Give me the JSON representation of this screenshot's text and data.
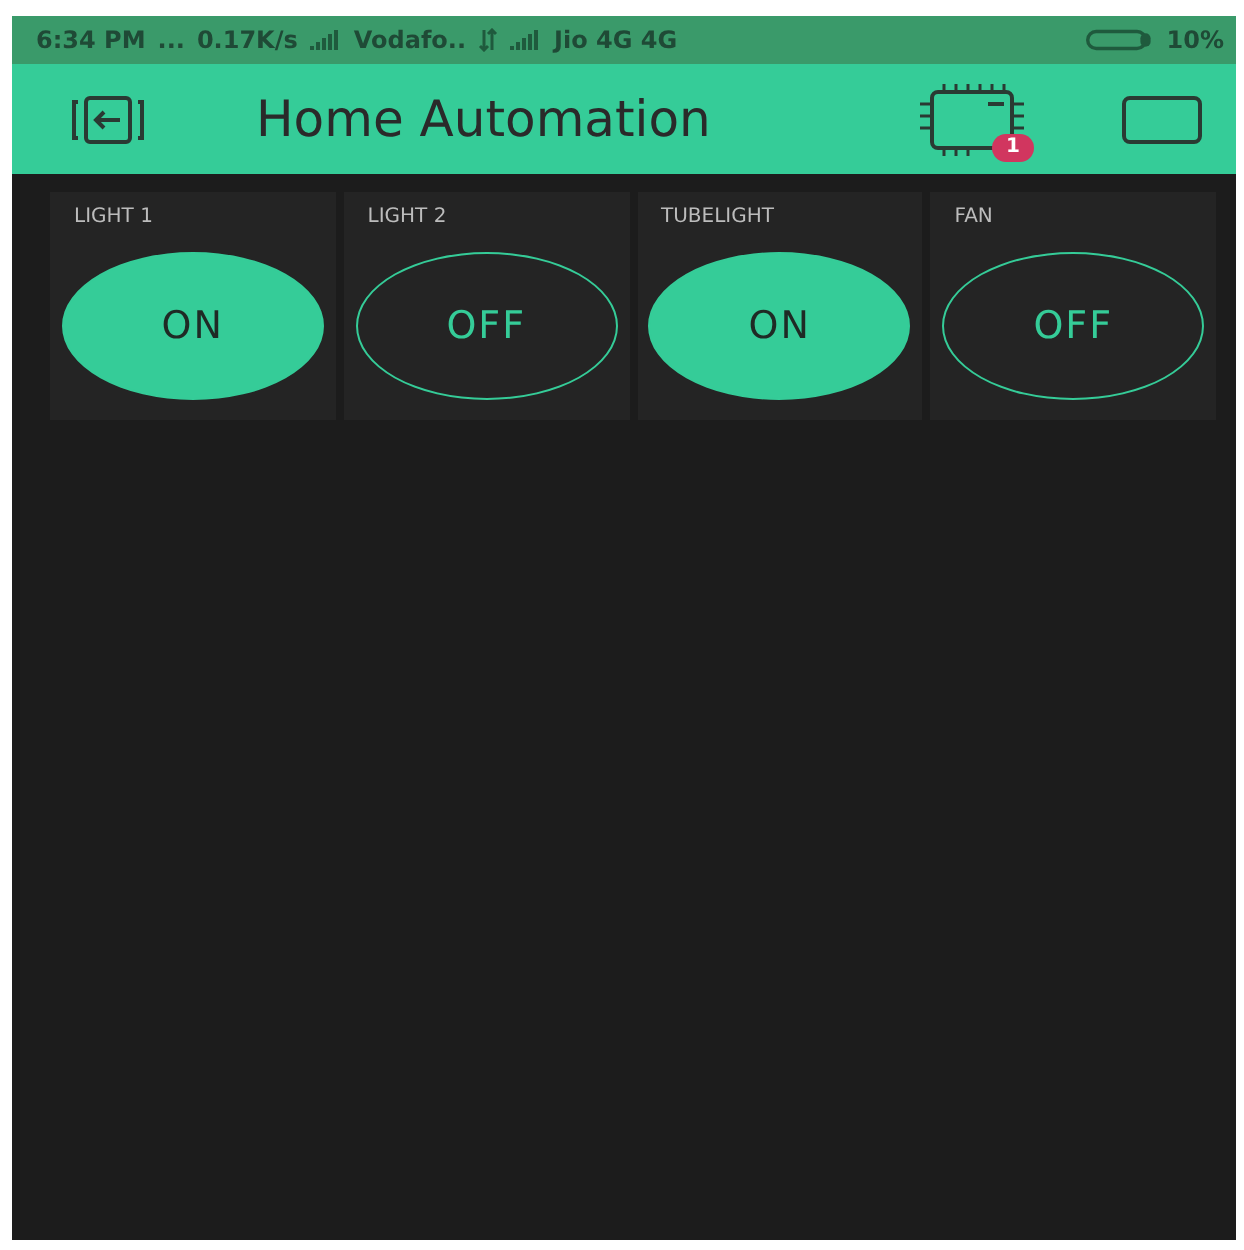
{
  "status_bar": {
    "time": "6:34 PM",
    "dots": "...",
    "speed": "0.17K/s",
    "carrier_1": "Vodafo..",
    "carrier_2": "Jio 4G 4G",
    "battery": "10%"
  },
  "header": {
    "title": "Home Automation",
    "badge": "1"
  },
  "widgets": [
    {
      "label": "LIGHT 1",
      "on": true,
      "text": "ON"
    },
    {
      "label": "LIGHT 2",
      "on": false,
      "text": "OFF"
    },
    {
      "label": "TUBELIGHT",
      "on": true,
      "text": "ON"
    },
    {
      "label": "FAN",
      "on": false,
      "text": "OFF"
    }
  ]
}
